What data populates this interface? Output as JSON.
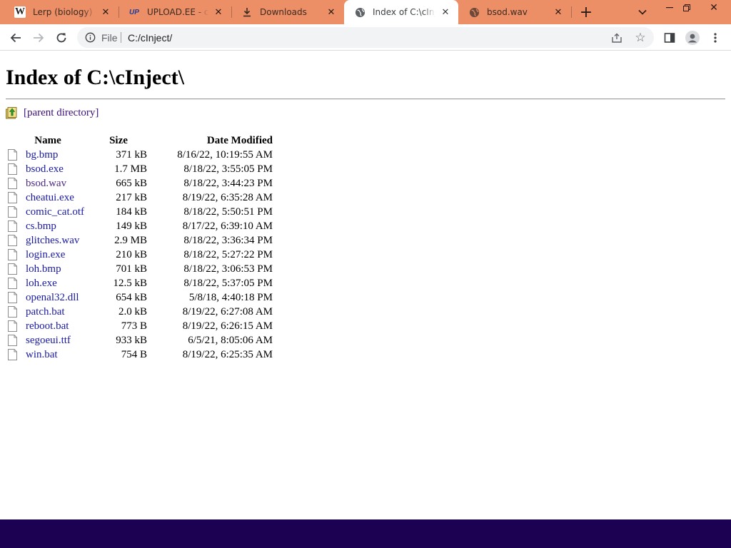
{
  "colors": {
    "tabstrip": "#ec8e66",
    "taskbar": "#1c0052",
    "link": "#1a1aa6",
    "visited_link": "#4d2a86"
  },
  "browser": {
    "tabs": [
      {
        "title": "Lerp (biology) - Wiki",
        "favicon": "wikipedia-w-icon",
        "active": false
      },
      {
        "title": "UPLOAD.EE - cinject",
        "favicon": "upload-ee-icon",
        "active": false
      },
      {
        "title": "Downloads",
        "favicon": "download-icon",
        "active": false
      },
      {
        "title": "Index of C:\\cInject\\",
        "favicon": "globe-icon",
        "active": true
      },
      {
        "title": "bsod.wav",
        "favicon": "globe-icon",
        "active": false
      }
    ],
    "new_tab_symbol": "+",
    "address": {
      "scheme_label": "File",
      "url": "C:/cInject/"
    }
  },
  "page": {
    "heading": "Index of C:\\cInject\\",
    "parent_link": "[parent directory]",
    "columns": {
      "name": "Name",
      "size": "Size",
      "date": "Date Modified"
    },
    "files": [
      {
        "name": "bg.bmp",
        "size": "371 kB",
        "date": "8/16/22, 10:19:55 AM",
        "visited": false
      },
      {
        "name": "bsod.exe",
        "size": "1.7 MB",
        "date": "8/18/22, 3:55:05 PM",
        "visited": false
      },
      {
        "name": "bsod.wav",
        "size": "665 kB",
        "date": "8/18/22, 3:44:23 PM",
        "visited": true
      },
      {
        "name": "cheatui.exe",
        "size": "217 kB",
        "date": "8/19/22, 6:35:28 AM",
        "visited": false
      },
      {
        "name": "comic_cat.otf",
        "size": "184 kB",
        "date": "8/18/22, 5:50:51 PM",
        "visited": false
      },
      {
        "name": "cs.bmp",
        "size": "149 kB",
        "date": "8/17/22, 6:39:10 AM",
        "visited": false
      },
      {
        "name": "glitches.wav",
        "size": "2.9 MB",
        "date": "8/18/22, 3:36:34 PM",
        "visited": false
      },
      {
        "name": "login.exe",
        "size": "210 kB",
        "date": "8/18/22, 5:27:22 PM",
        "visited": false
      },
      {
        "name": "loh.bmp",
        "size": "701 kB",
        "date": "8/18/22, 3:06:53 PM",
        "visited": false
      },
      {
        "name": "loh.exe",
        "size": "12.5 kB",
        "date": "8/18/22, 5:37:05 PM",
        "visited": false
      },
      {
        "name": "openal32.dll",
        "size": "654 kB",
        "date": "5/8/18, 4:40:18 PM",
        "visited": false
      },
      {
        "name": "patch.bat",
        "size": "2.0 kB",
        "date": "8/19/22, 6:27:08 AM",
        "visited": false
      },
      {
        "name": "reboot.bat",
        "size": "773 B",
        "date": "8/19/22, 6:26:15 AM",
        "visited": false
      },
      {
        "name": "segoeui.ttf",
        "size": "933 kB",
        "date": "6/5/21, 8:05:06 AM",
        "visited": false
      },
      {
        "name": "win.bat",
        "size": "754 B",
        "date": "8/19/22, 6:25:35 AM",
        "visited": false
      }
    ]
  }
}
